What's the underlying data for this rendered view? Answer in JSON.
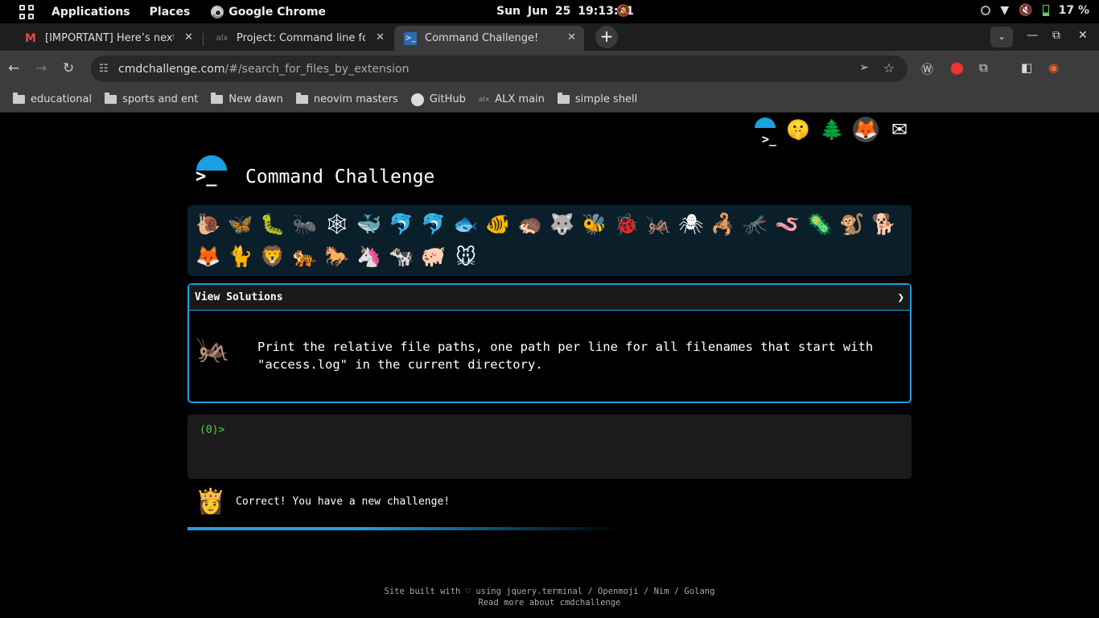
{
  "system_bar": {
    "applications": "Applications",
    "places": "Places",
    "active_app": "Google Chrome",
    "clock": "Sun Jun 25  19:13:21",
    "battery": "17 %"
  },
  "tabs": [
    {
      "title": "[IMPORTANT] Here’s next w",
      "favicon": "gmail-icon"
    },
    {
      "title": "Project: Command line for th",
      "favicon": "alx-icon"
    },
    {
      "title": "Command Challenge!",
      "favicon": "terminal-icon",
      "active": true
    }
  ],
  "address_bar": {
    "host": "cmdchallenge.com",
    "path": "/#/search_for_files_by_extension"
  },
  "bookmarks": [
    {
      "label": "educational",
      "icon": "folder-icon"
    },
    {
      "label": "sports and ent",
      "icon": "folder-icon"
    },
    {
      "label": "New dawn",
      "icon": "folder-icon"
    },
    {
      "label": "neovim masters",
      "icon": "folder-icon"
    },
    {
      "label": "GitHub",
      "icon": "github-icon"
    },
    {
      "label": "ALX main",
      "icon": "alx-icon"
    },
    {
      "label": "simple shell",
      "icon": "folder-icon"
    }
  ],
  "page": {
    "title": "Command Challenge",
    "header_icons": [
      "cmdchallenge-logo-icon",
      "shushing-face-icon",
      "tree-icon",
      "gitlab-icon",
      "envelope-icon"
    ],
    "animals": [
      "🐌",
      "🦋",
      "🐛",
      "🐜",
      "🕸",
      "🐳",
      "🐬",
      "🐬",
      "🐟",
      "🐠",
      "🦔",
      "🐺",
      "🐝",
      "🐞",
      "🦗",
      "🕷",
      "🦂",
      "🦟",
      "🪱",
      "🦠",
      "🐒",
      "🐕",
      "🦊",
      "🐈",
      "🦁",
      "🐅",
      "🐎",
      "🦄",
      "🐄",
      "🐖",
      "🐭"
    ],
    "view_solutions": "View Solutions",
    "view_solutions_arrow": "❯",
    "challenge_text": "Print the relative file paths, one path per line for all filenames that start with \"access.log\" in the current directory.",
    "prompt": "(0)>",
    "result_message": "Correct! You have a new challenge!",
    "footer_line1": "Site built with ♡ using jquery.terminal / Openmoji / Nim / Golang",
    "footer_line2": "Read more about cmdchallenge"
  },
  "colors": {
    "accent": "#1ba1e2",
    "prompt_green": "#4dd14d",
    "panel": "#0a1f2a"
  }
}
